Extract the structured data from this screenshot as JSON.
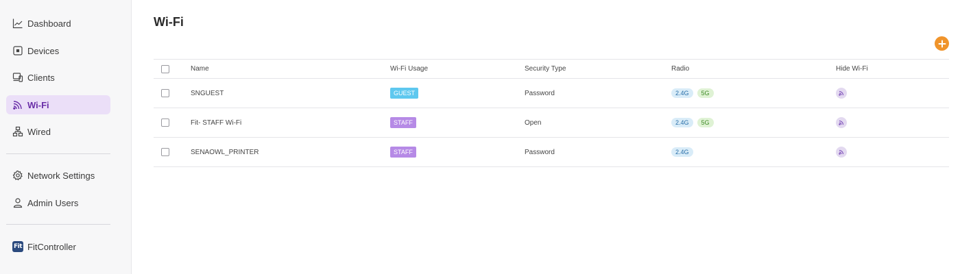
{
  "sidebar": {
    "items": [
      {
        "label": "Dashboard",
        "icon": "chart-line-icon"
      },
      {
        "label": "Devices",
        "icon": "device-icon"
      },
      {
        "label": "Clients",
        "icon": "clients-icon"
      },
      {
        "label": "Wi-Fi",
        "icon": "wifi-icon",
        "active": true
      },
      {
        "label": "Wired",
        "icon": "network-icon"
      }
    ],
    "settings_items": [
      {
        "label": "Network Settings",
        "icon": "gear-icon"
      },
      {
        "label": "Admin Users",
        "icon": "user-icon"
      }
    ],
    "app": {
      "label": "FitController",
      "logo_text": "Fit"
    }
  },
  "page": {
    "title": "Wi-Fi"
  },
  "table": {
    "headers": {
      "name": "Name",
      "usage": "Wi-Fi Usage",
      "security": "Security Type",
      "radio": "Radio",
      "hide": "Hide Wi-Fi"
    },
    "rows": [
      {
        "name": "SNGUEST",
        "usage": "GUEST",
        "security": "Password",
        "radio_24": "2.4G",
        "radio_5": "5G"
      },
      {
        "name": "Fit- STAFF Wi-Fi",
        "usage": "STAFF",
        "security": "Open",
        "radio_24": "2.4G",
        "radio_5": "5G"
      },
      {
        "name": "SENAOWL_PRINTER",
        "usage": "STAFF",
        "security": "Password",
        "radio_24": "2.4G"
      }
    ]
  },
  "colors": {
    "accent": "#f0942b",
    "active_nav_bg": "#ebdff8",
    "guest_badge": "#5ec8ef",
    "staff_badge": "#b68ae6"
  }
}
